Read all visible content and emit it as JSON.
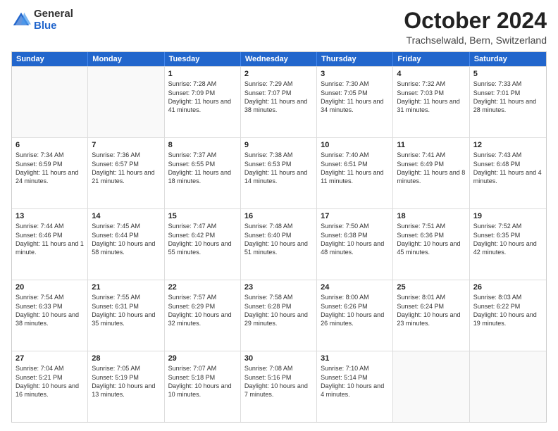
{
  "header": {
    "logo_general": "General",
    "logo_blue": "Blue",
    "title": "October 2024",
    "subtitle": "Trachselwald, Bern, Switzerland"
  },
  "calendar": {
    "days_of_week": [
      "Sunday",
      "Monday",
      "Tuesday",
      "Wednesday",
      "Thursday",
      "Friday",
      "Saturday"
    ],
    "weeks": [
      [
        {
          "day": "",
          "info": "",
          "empty": true
        },
        {
          "day": "",
          "info": "",
          "empty": true
        },
        {
          "day": "1",
          "info": "Sunrise: 7:28 AM\nSunset: 7:09 PM\nDaylight: 11 hours and 41 minutes.",
          "empty": false
        },
        {
          "day": "2",
          "info": "Sunrise: 7:29 AM\nSunset: 7:07 PM\nDaylight: 11 hours and 38 minutes.",
          "empty": false
        },
        {
          "day": "3",
          "info": "Sunrise: 7:30 AM\nSunset: 7:05 PM\nDaylight: 11 hours and 34 minutes.",
          "empty": false
        },
        {
          "day": "4",
          "info": "Sunrise: 7:32 AM\nSunset: 7:03 PM\nDaylight: 11 hours and 31 minutes.",
          "empty": false
        },
        {
          "day": "5",
          "info": "Sunrise: 7:33 AM\nSunset: 7:01 PM\nDaylight: 11 hours and 28 minutes.",
          "empty": false
        }
      ],
      [
        {
          "day": "6",
          "info": "Sunrise: 7:34 AM\nSunset: 6:59 PM\nDaylight: 11 hours and 24 minutes.",
          "empty": false
        },
        {
          "day": "7",
          "info": "Sunrise: 7:36 AM\nSunset: 6:57 PM\nDaylight: 11 hours and 21 minutes.",
          "empty": false
        },
        {
          "day": "8",
          "info": "Sunrise: 7:37 AM\nSunset: 6:55 PM\nDaylight: 11 hours and 18 minutes.",
          "empty": false
        },
        {
          "day": "9",
          "info": "Sunrise: 7:38 AM\nSunset: 6:53 PM\nDaylight: 11 hours and 14 minutes.",
          "empty": false
        },
        {
          "day": "10",
          "info": "Sunrise: 7:40 AM\nSunset: 6:51 PM\nDaylight: 11 hours and 11 minutes.",
          "empty": false
        },
        {
          "day": "11",
          "info": "Sunrise: 7:41 AM\nSunset: 6:49 PM\nDaylight: 11 hours and 8 minutes.",
          "empty": false
        },
        {
          "day": "12",
          "info": "Sunrise: 7:43 AM\nSunset: 6:48 PM\nDaylight: 11 hours and 4 minutes.",
          "empty": false
        }
      ],
      [
        {
          "day": "13",
          "info": "Sunrise: 7:44 AM\nSunset: 6:46 PM\nDaylight: 11 hours and 1 minute.",
          "empty": false
        },
        {
          "day": "14",
          "info": "Sunrise: 7:45 AM\nSunset: 6:44 PM\nDaylight: 10 hours and 58 minutes.",
          "empty": false
        },
        {
          "day": "15",
          "info": "Sunrise: 7:47 AM\nSunset: 6:42 PM\nDaylight: 10 hours and 55 minutes.",
          "empty": false
        },
        {
          "day": "16",
          "info": "Sunrise: 7:48 AM\nSunset: 6:40 PM\nDaylight: 10 hours and 51 minutes.",
          "empty": false
        },
        {
          "day": "17",
          "info": "Sunrise: 7:50 AM\nSunset: 6:38 PM\nDaylight: 10 hours and 48 minutes.",
          "empty": false
        },
        {
          "day": "18",
          "info": "Sunrise: 7:51 AM\nSunset: 6:36 PM\nDaylight: 10 hours and 45 minutes.",
          "empty": false
        },
        {
          "day": "19",
          "info": "Sunrise: 7:52 AM\nSunset: 6:35 PM\nDaylight: 10 hours and 42 minutes.",
          "empty": false
        }
      ],
      [
        {
          "day": "20",
          "info": "Sunrise: 7:54 AM\nSunset: 6:33 PM\nDaylight: 10 hours and 38 minutes.",
          "empty": false
        },
        {
          "day": "21",
          "info": "Sunrise: 7:55 AM\nSunset: 6:31 PM\nDaylight: 10 hours and 35 minutes.",
          "empty": false
        },
        {
          "day": "22",
          "info": "Sunrise: 7:57 AM\nSunset: 6:29 PM\nDaylight: 10 hours and 32 minutes.",
          "empty": false
        },
        {
          "day": "23",
          "info": "Sunrise: 7:58 AM\nSunset: 6:28 PM\nDaylight: 10 hours and 29 minutes.",
          "empty": false
        },
        {
          "day": "24",
          "info": "Sunrise: 8:00 AM\nSunset: 6:26 PM\nDaylight: 10 hours and 26 minutes.",
          "empty": false
        },
        {
          "day": "25",
          "info": "Sunrise: 8:01 AM\nSunset: 6:24 PM\nDaylight: 10 hours and 23 minutes.",
          "empty": false
        },
        {
          "day": "26",
          "info": "Sunrise: 8:03 AM\nSunset: 6:22 PM\nDaylight: 10 hours and 19 minutes.",
          "empty": false
        }
      ],
      [
        {
          "day": "27",
          "info": "Sunrise: 7:04 AM\nSunset: 5:21 PM\nDaylight: 10 hours and 16 minutes.",
          "empty": false
        },
        {
          "day": "28",
          "info": "Sunrise: 7:05 AM\nSunset: 5:19 PM\nDaylight: 10 hours and 13 minutes.",
          "empty": false
        },
        {
          "day": "29",
          "info": "Sunrise: 7:07 AM\nSunset: 5:18 PM\nDaylight: 10 hours and 10 minutes.",
          "empty": false
        },
        {
          "day": "30",
          "info": "Sunrise: 7:08 AM\nSunset: 5:16 PM\nDaylight: 10 hours and 7 minutes.",
          "empty": false
        },
        {
          "day": "31",
          "info": "Sunrise: 7:10 AM\nSunset: 5:14 PM\nDaylight: 10 hours and 4 minutes.",
          "empty": false
        },
        {
          "day": "",
          "info": "",
          "empty": true
        },
        {
          "day": "",
          "info": "",
          "empty": true
        }
      ]
    ]
  }
}
